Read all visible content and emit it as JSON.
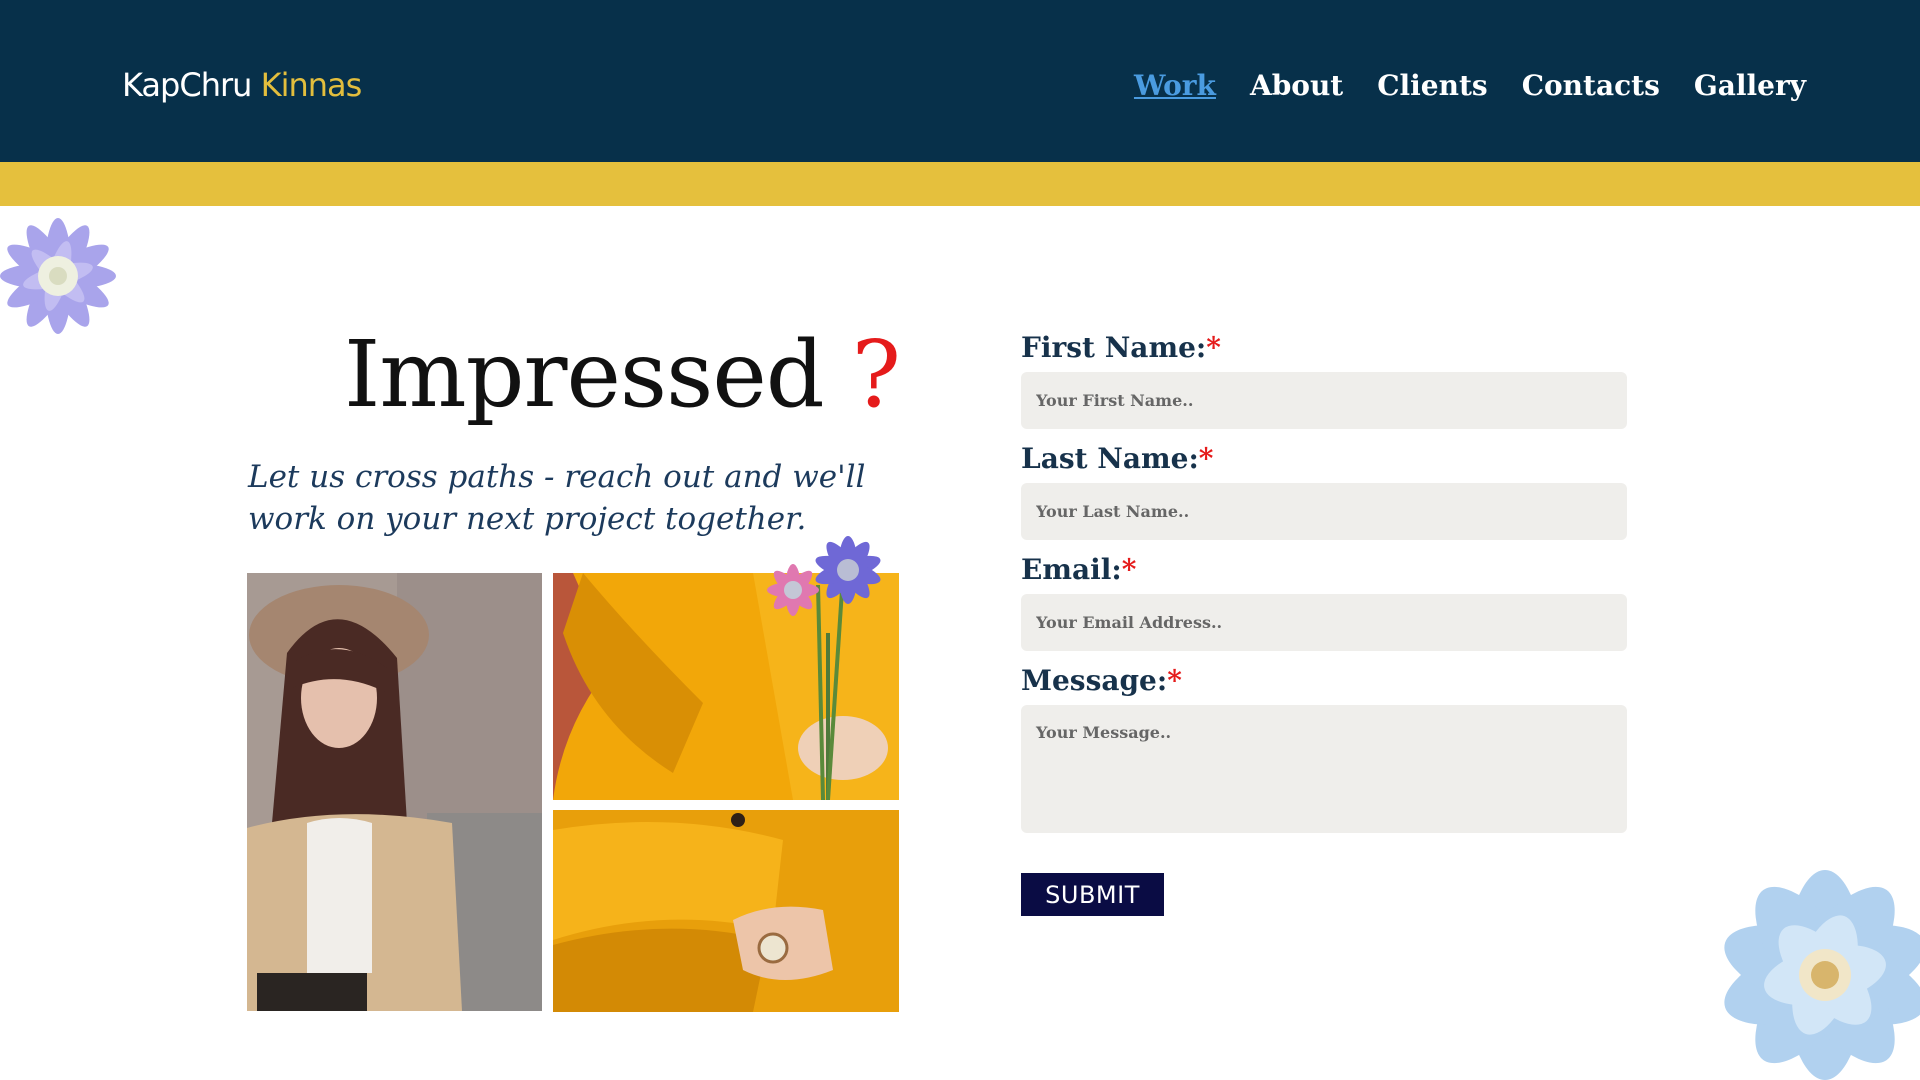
{
  "brand": {
    "part1": "KapChru",
    "part2": "Kinnas"
  },
  "nav": {
    "items": [
      {
        "label": "Work",
        "active": true
      },
      {
        "label": "About"
      },
      {
        "label": "Clients"
      },
      {
        "label": "Contacts"
      },
      {
        "label": "Gallery"
      }
    ]
  },
  "hero": {
    "heading": "Impressed",
    "heading_mark": "?",
    "tagline_line1": "Let us cross paths - reach out and we'll",
    "tagline_line2": "work on your next project together."
  },
  "form": {
    "first_name": {
      "label": "First Name:",
      "required_mark": "*",
      "placeholder": "Your First Name.."
    },
    "last_name": {
      "label": "Last Name:",
      "required_mark": "*",
      "placeholder": "Your Last Name.."
    },
    "email": {
      "label": "Email:",
      "required_mark": "*",
      "placeholder": "Your Email Address.."
    },
    "message": {
      "label": "Message:",
      "required_mark": "*",
      "placeholder": "Your Message.."
    },
    "submit_label": "SUBMIT"
  },
  "colors": {
    "header_bg": "#07304a",
    "accent_band": "#e5c03d",
    "brand_accent": "#e3be3d",
    "nav_active": "#4a9be0",
    "required": "#e51b1b",
    "submit_bg": "#0a0c44"
  }
}
